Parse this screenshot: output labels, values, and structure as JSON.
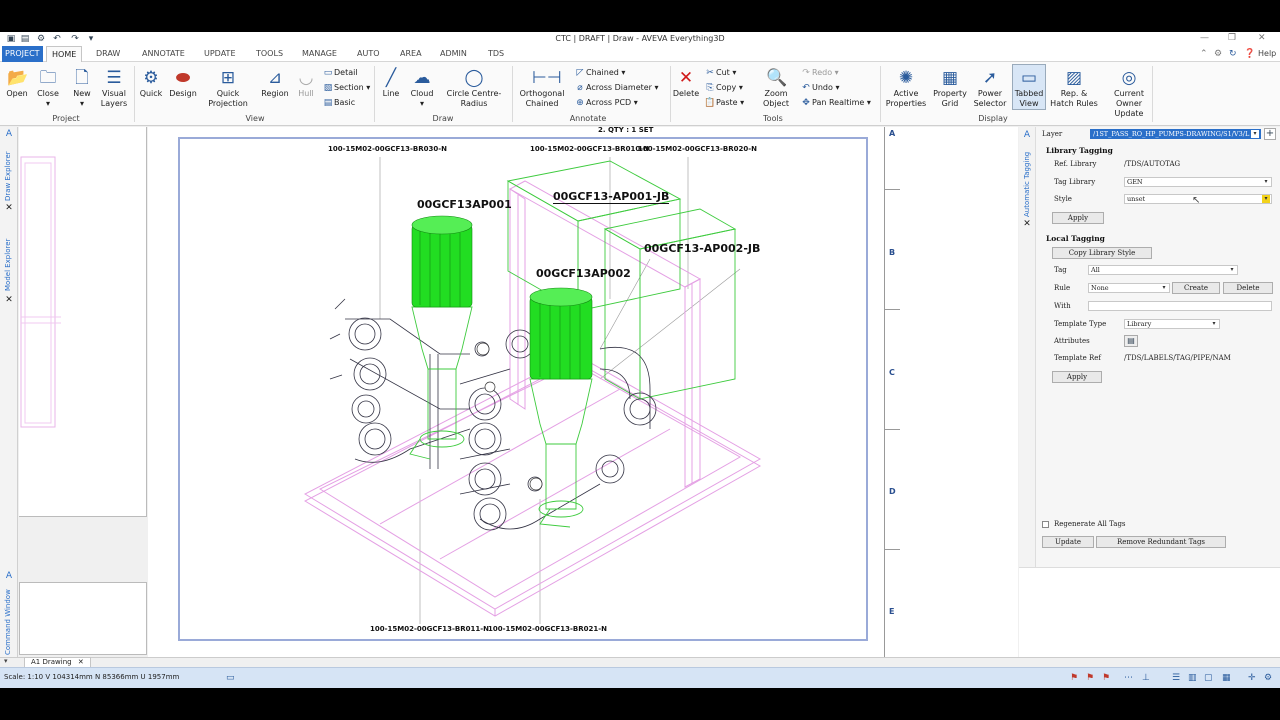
{
  "window": {
    "title": "CTC | DRAFT | Draw - AVEVA Everything3D",
    "help": "Help"
  },
  "tabs": [
    "PROJECT",
    "HOME",
    "DRAW",
    "ANNOTATE",
    "UPDATE",
    "TOOLS",
    "MANAGE",
    "AUTO",
    "AREA",
    "ADMIN",
    "TDS"
  ],
  "ribbon": {
    "project": {
      "open": "Open",
      "close": "Close",
      "new": "New",
      "visual_layers": "Visual\nLayers",
      "group": "Project"
    },
    "view": {
      "quick": "Quick",
      "design": "Design",
      "quick_projection": "Quick\nProjection",
      "region": "Region",
      "hull": "Hull",
      "detail": "Detail",
      "section": "Section",
      "basic": "Basic",
      "group": "View"
    },
    "draw": {
      "line": "Line",
      "cloud": "Cloud",
      "circle": "Circle Centre-\nRadius",
      "group": "Draw"
    },
    "annotate": {
      "orthogonal": "Orthogonal\nChained",
      "chained": "Chained",
      "across_diameter": "Across Diameter",
      "across_pcd": "Across PCD",
      "group": "Annotate"
    },
    "tools": {
      "delete": "Delete",
      "cut": "Cut",
      "copy": "Copy",
      "paste": "Paste",
      "zoom_object": "Zoom\nObject",
      "redo": "Redo",
      "undo": "Undo",
      "pan_realtime": "Pan Realtime",
      "group": "Tools"
    },
    "display": {
      "active_properties": "Active\nProperties",
      "property_grid": "Property\nGrid",
      "power_selector": "Power\nSelector",
      "tabbed_view": "Tabbed\nView",
      "rep_hatch": "Rep. &\nHatch Rules",
      "current_owner": "Current\nOwner\nUpdate",
      "group": "Display"
    }
  },
  "left_panels": {
    "draw_explorer": "Draw Explorer",
    "model_explorer": "Model Explorer",
    "command_window": "Command Window"
  },
  "drawing": {
    "qty": "2. QTY : 1 SET",
    "pipe_labels_top": [
      "100-15M02-00GCF13-BR030-N",
      "100-15M02-00GCF13-BR010-N",
      "100-15M02-00GCF13-BR020-N"
    ],
    "pipe_labels_bottom": [
      "100-15M02-00GCF13-BR011-N",
      "100-15M02-00GCF13-BR021-N"
    ],
    "tags": [
      "00GCF13AP001",
      "00GCF13-AP001-JB",
      "00GCF13-AP002-JB",
      "00GCF13AP002"
    ],
    "zones": [
      "A",
      "B",
      "C",
      "D",
      "E"
    ]
  },
  "tagging": {
    "strip_label": "Automatic Tagging",
    "layer_label": "Layer",
    "layer_value": "/1ST_PASS_RO_HP_PUMPS-DRAWING/S1/V3/L",
    "library_tagging": "Library Tagging",
    "ref_library_label": "Ref. Library",
    "ref_library_value": "/TDS/AUTOTAG",
    "tag_library_label": "Tag Library",
    "tag_library_value": "GEN",
    "style_label": "Style",
    "style_value": "unset",
    "apply": "Apply",
    "local_tagging": "Local Tagging",
    "copy_library_style": "Copy Library Style",
    "tag_label": "Tag",
    "tag_value": "All",
    "rule_label": "Rule",
    "rule_value": "None",
    "create": "Create",
    "delete": "Delete",
    "with_label": "With",
    "with_value": "",
    "template_type_label": "Template Type",
    "template_type_value": "Library",
    "attributes_label": "Attributes",
    "template_ref_label": "Template Ref",
    "template_ref_value": "/TDS/LABELS/TAG/PIPE/NAM",
    "apply2": "Apply",
    "regenerate_all": "Regenerate All Tags",
    "update": "Update",
    "remove_redundant": "Remove Redundant Tags"
  },
  "doc_tab": "A1 Drawing",
  "status": "Scale: 1:10  V 104314mm N 85366mm U 1957mm"
}
